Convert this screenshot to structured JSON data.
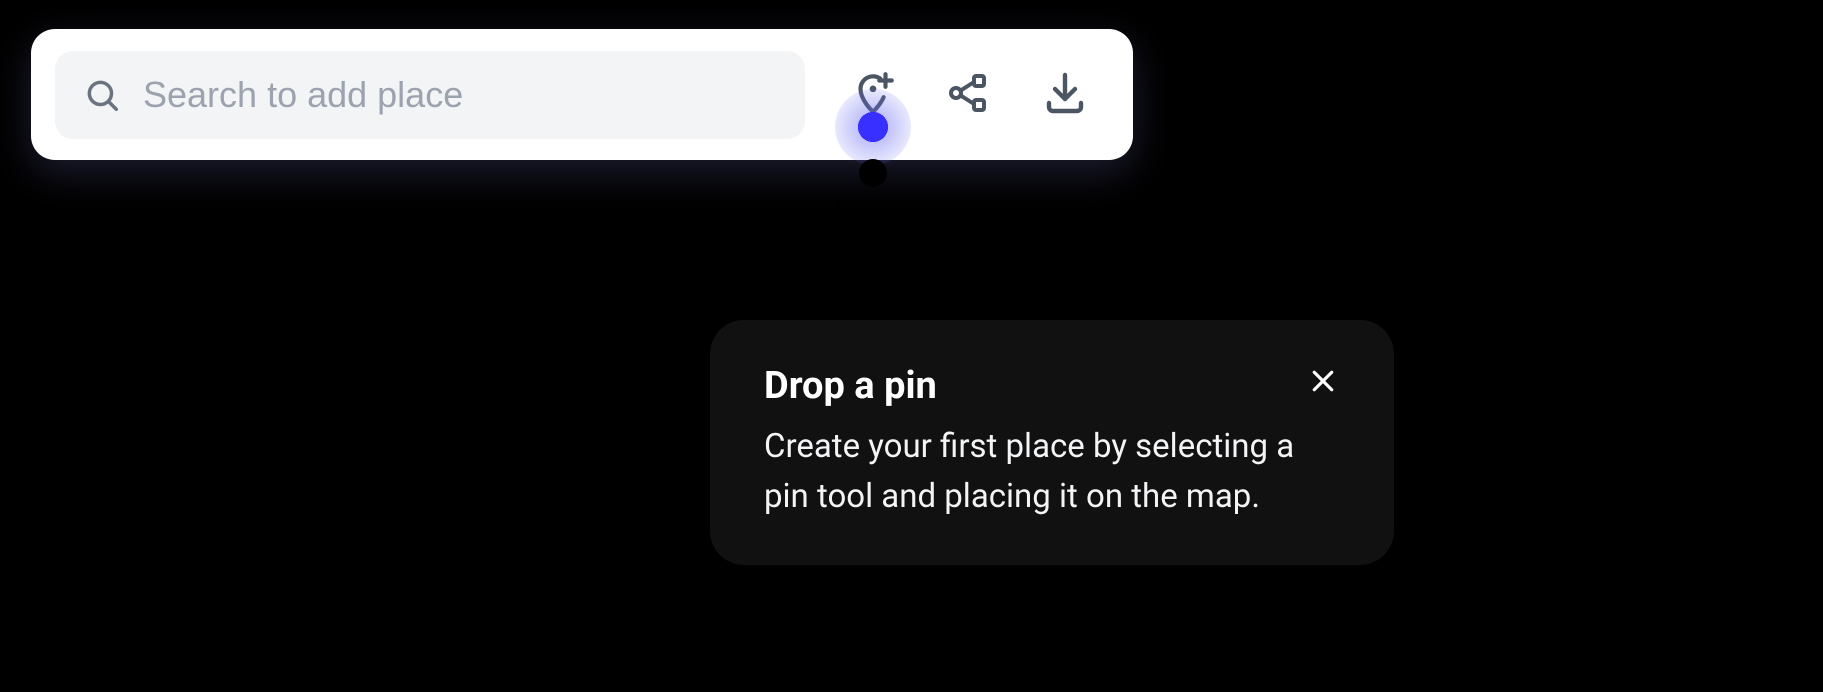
{
  "toolbar": {
    "search": {
      "placeholder": "Search to add place",
      "value": ""
    },
    "icons": {
      "pin": "add-pin-icon",
      "share": "share-icon",
      "download": "download-icon"
    }
  },
  "tooltip": {
    "title": "Drop a pin",
    "body": "Create your first place by selecting a pin tool and placing it on the map."
  }
}
